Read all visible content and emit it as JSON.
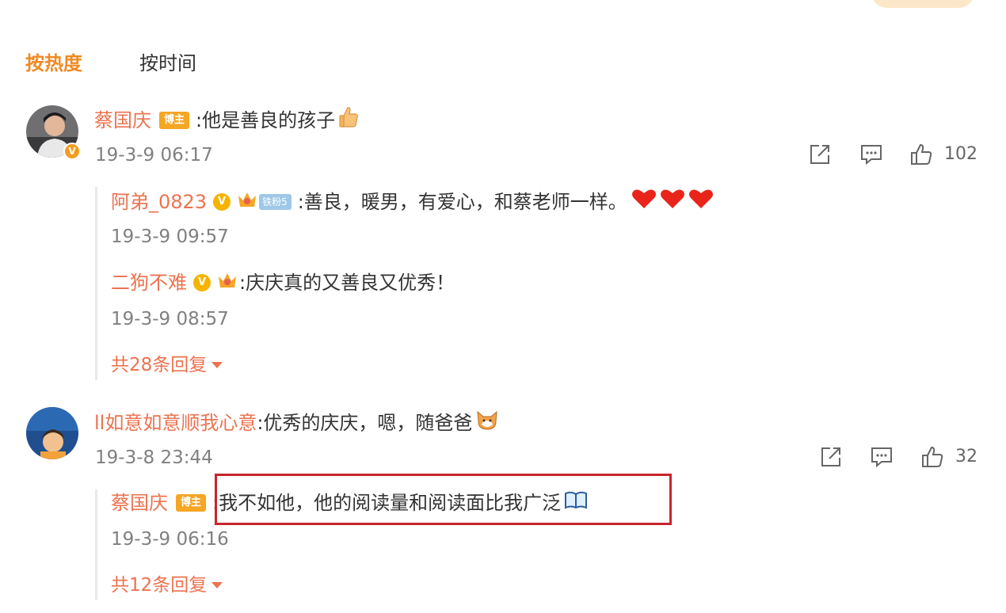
{
  "sort_tabs": {
    "hot": "按热度",
    "time": "按时间"
  },
  "comments": [
    {
      "user": "蔡国庆",
      "author_badge": "博主",
      "text": ":他是善良的孩子",
      "time": "19-3-9 06:17",
      "like_count": "102",
      "replies": [
        {
          "user": "阿弟_0823",
          "fan_badge": "铁粉5",
          "text": ":善良，暖男，有爱心，和蔡老师一样。",
          "time": "19-3-9 09:57"
        },
        {
          "user": "二狗不难",
          "text": ":庆庆真的又善良又优秀！",
          "time": "19-3-9 08:57"
        }
      ],
      "more_replies": "共28条回复"
    },
    {
      "user": "ll如意如意顺我心意",
      "text": ":优秀的庆庆，嗯，随爸爸",
      "time": "19-3-8 23:44",
      "like_count": "32",
      "replies": [
        {
          "user": "蔡国庆",
          "author_badge": "博主",
          "text": ":我不如他，他的阅读量和阅读面比我广泛",
          "time": "19-3-9 06:16"
        }
      ],
      "more_replies": "共12条回复"
    }
  ],
  "colors": {
    "username": "#eb7350",
    "sort_active": "#f08a24",
    "highlight_box": "#c8252c",
    "verify": "#f59b1e"
  },
  "icons": [
    "share-icon",
    "comment-icon",
    "like-icon",
    "thumbs-up-emoji",
    "heart-emoji",
    "cat-emoji",
    "book-emoji",
    "crown-icon",
    "verified-v-icon"
  ]
}
